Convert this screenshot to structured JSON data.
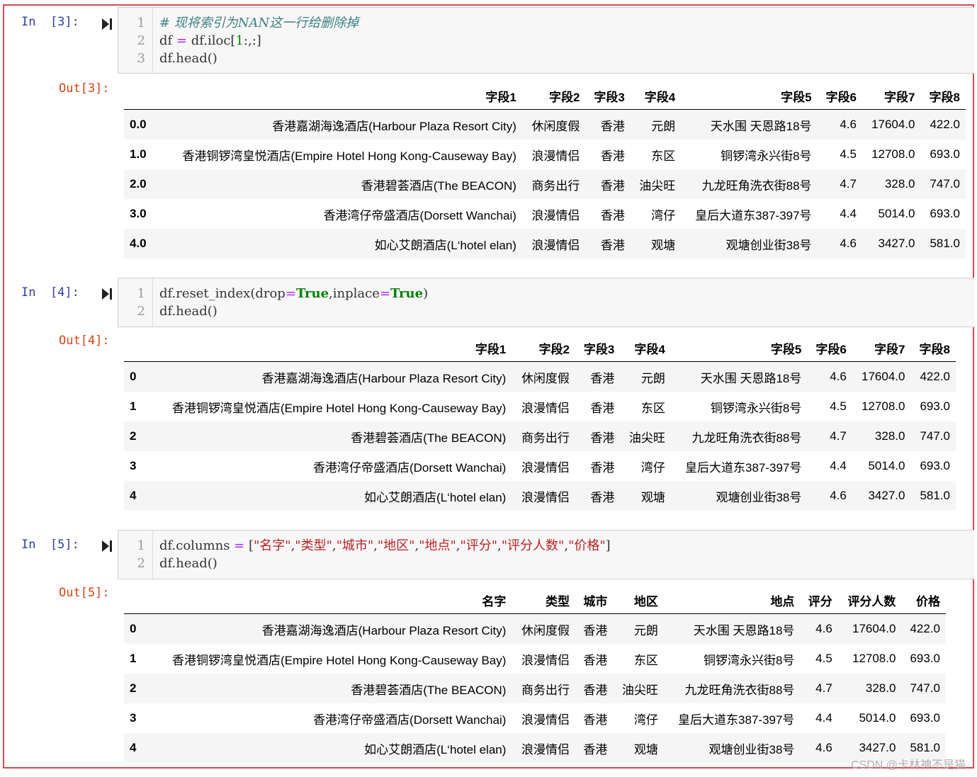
{
  "cells": [
    {
      "in_prompt": "In  [3]:",
      "out_prompt": "Out[3]:",
      "code_lines": [
        {
          "num": "1",
          "parts": [
            {
              "t": "# 现将索引为NAN这一行给删除掉",
              "c": "comment"
            }
          ]
        },
        {
          "num": "2",
          "parts": [
            {
              "t": "df ",
              "c": ""
            },
            {
              "t": "=",
              "c": "op"
            },
            {
              "t": " df.iloc[",
              "c": ""
            },
            {
              "t": "1",
              "c": "num"
            },
            {
              "t": ":,:]",
              "c": ""
            }
          ]
        },
        {
          "num": "3",
          "parts": [
            {
              "t": "df.head()",
              "c": ""
            }
          ]
        }
      ],
      "table": {
        "columns": [
          "字段1",
          "字段2",
          "字段3",
          "字段4",
          "字段5",
          "字段6",
          "字段7",
          "字段8"
        ],
        "rows": [
          {
            "index": "0.0",
            "cells": [
              "香港嘉湖海逸酒店(Harbour Plaza Resort City)",
              "休闲度假",
              "香港",
              "元朗",
              "天水围 天恩路18号",
              "4.6",
              "17604.0",
              "422.0"
            ]
          },
          {
            "index": "1.0",
            "cells": [
              "香港铜锣湾皇悦酒店(Empire Hotel Hong Kong-Causeway Bay)",
              "浪漫情侣",
              "香港",
              "东区",
              "铜锣湾永兴街8号",
              "4.5",
              "12708.0",
              "693.0"
            ]
          },
          {
            "index": "2.0",
            "cells": [
              "香港碧荟酒店(The BEACON)",
              "商务出行",
              "香港",
              "油尖旺",
              "九龙旺角洗衣街88号",
              "4.7",
              "328.0",
              "747.0"
            ]
          },
          {
            "index": "3.0",
            "cells": [
              "香港湾仔帝盛酒店(Dorsett Wanchai)",
              "浪漫情侣",
              "香港",
              "湾仔",
              "皇后大道东387-397号",
              "4.4",
              "5014.0",
              "693.0"
            ]
          },
          {
            "index": "4.0",
            "cells": [
              "如心艾朗酒店(L‘hotel elan)",
              "浪漫情侣",
              "香港",
              "观塘",
              "观塘创业街38号",
              "4.6",
              "3427.0",
              "581.0"
            ]
          }
        ]
      }
    },
    {
      "in_prompt": "In  [4]:",
      "out_prompt": "Out[4]:",
      "code_lines": [
        {
          "num": "1",
          "parts": [
            {
              "t": "df.reset_index(drop",
              "c": ""
            },
            {
              "t": "=",
              "c": "op"
            },
            {
              "t": "True",
              "c": "kw"
            },
            {
              "t": ",inplace",
              "c": ""
            },
            {
              "t": "=",
              "c": "op"
            },
            {
              "t": "True",
              "c": "kw"
            },
            {
              "t": ")",
              "c": ""
            }
          ]
        },
        {
          "num": "2",
          "parts": [
            {
              "t": "df.head()",
              "c": ""
            }
          ]
        }
      ],
      "table": {
        "columns": [
          "字段1",
          "字段2",
          "字段3",
          "字段4",
          "字段5",
          "字段6",
          "字段7",
          "字段8"
        ],
        "rows": [
          {
            "index": "0",
            "cells": [
              "香港嘉湖海逸酒店(Harbour Plaza Resort City)",
              "休闲度假",
              "香港",
              "元朗",
              "天水围 天恩路18号",
              "4.6",
              "17604.0",
              "422.0"
            ]
          },
          {
            "index": "1",
            "cells": [
              "香港铜锣湾皇悦酒店(Empire Hotel Hong Kong-Causeway Bay)",
              "浪漫情侣",
              "香港",
              "东区",
              "铜锣湾永兴街8号",
              "4.5",
              "12708.0",
              "693.0"
            ]
          },
          {
            "index": "2",
            "cells": [
              "香港碧荟酒店(The BEACON)",
              "商务出行",
              "香港",
              "油尖旺",
              "九龙旺角洗衣街88号",
              "4.7",
              "328.0",
              "747.0"
            ]
          },
          {
            "index": "3",
            "cells": [
              "香港湾仔帝盛酒店(Dorsett Wanchai)",
              "浪漫情侣",
              "香港",
              "湾仔",
              "皇后大道东387-397号",
              "4.4",
              "5014.0",
              "693.0"
            ]
          },
          {
            "index": "4",
            "cells": [
              "如心艾朗酒店(L‘hotel elan)",
              "浪漫情侣",
              "香港",
              "观塘",
              "观塘创业街38号",
              "4.6",
              "3427.0",
              "581.0"
            ]
          }
        ]
      }
    },
    {
      "in_prompt": "In  [5]:",
      "out_prompt": "Out[5]:",
      "code_lines": [
        {
          "num": "1",
          "parts": [
            {
              "t": "df.columns ",
              "c": ""
            },
            {
              "t": "=",
              "c": "op"
            },
            {
              "t": " [",
              "c": ""
            },
            {
              "t": "\"名字\"",
              "c": "str"
            },
            {
              "t": ",",
              "c": ""
            },
            {
              "t": "\"类型\"",
              "c": "str"
            },
            {
              "t": ",",
              "c": ""
            },
            {
              "t": "\"城市\"",
              "c": "str"
            },
            {
              "t": ",",
              "c": ""
            },
            {
              "t": "\"地区\"",
              "c": "str"
            },
            {
              "t": ",",
              "c": ""
            },
            {
              "t": "\"地点\"",
              "c": "str"
            },
            {
              "t": ",",
              "c": ""
            },
            {
              "t": "\"评分\"",
              "c": "str"
            },
            {
              "t": ",",
              "c": ""
            },
            {
              "t": "\"评分人数\"",
              "c": "str"
            },
            {
              "t": ",",
              "c": ""
            },
            {
              "t": "\"价格\"",
              "c": "str"
            },
            {
              "t": "]",
              "c": ""
            }
          ]
        },
        {
          "num": "2",
          "parts": [
            {
              "t": "df.head()",
              "c": ""
            }
          ]
        }
      ],
      "table": {
        "columns": [
          "名字",
          "类型",
          "城市",
          "地区",
          "地点",
          "评分",
          "评分人数",
          "价格"
        ],
        "rows": [
          {
            "index": "0",
            "cells": [
              "香港嘉湖海逸酒店(Harbour Plaza Resort City)",
              "休闲度假",
              "香港",
              "元朗",
              "天水围 天恩路18号",
              "4.6",
              "17604.0",
              "422.0"
            ]
          },
          {
            "index": "1",
            "cells": [
              "香港铜锣湾皇悦酒店(Empire Hotel Hong Kong-Causeway Bay)",
              "浪漫情侣",
              "香港",
              "东区",
              "铜锣湾永兴街8号",
              "4.5",
              "12708.0",
              "693.0"
            ]
          },
          {
            "index": "2",
            "cells": [
              "香港碧荟酒店(The BEACON)",
              "商务出行",
              "香港",
              "油尖旺",
              "九龙旺角洗衣街88号",
              "4.7",
              "328.0",
              "747.0"
            ]
          },
          {
            "index": "3",
            "cells": [
              "香港湾仔帝盛酒店(Dorsett Wanchai)",
              "浪漫情侣",
              "香港",
              "湾仔",
              "皇后大道东387-397号",
              "4.4",
              "5014.0",
              "693.0"
            ]
          },
          {
            "index": "4",
            "cells": [
              "如心艾朗酒店(L‘hotel elan)",
              "浪漫情侣",
              "香港",
              "观塘",
              "观塘创业街38号",
              "4.6",
              "3427.0",
              "581.0"
            ]
          }
        ]
      }
    }
  ],
  "watermark": "CSDN @卡林神不是猫",
  "icons": {
    "run": "run-cell-icon"
  },
  "colors": {
    "frame": "#e0464e",
    "in_prompt": "#303f9f",
    "out_prompt": "#d84315"
  }
}
